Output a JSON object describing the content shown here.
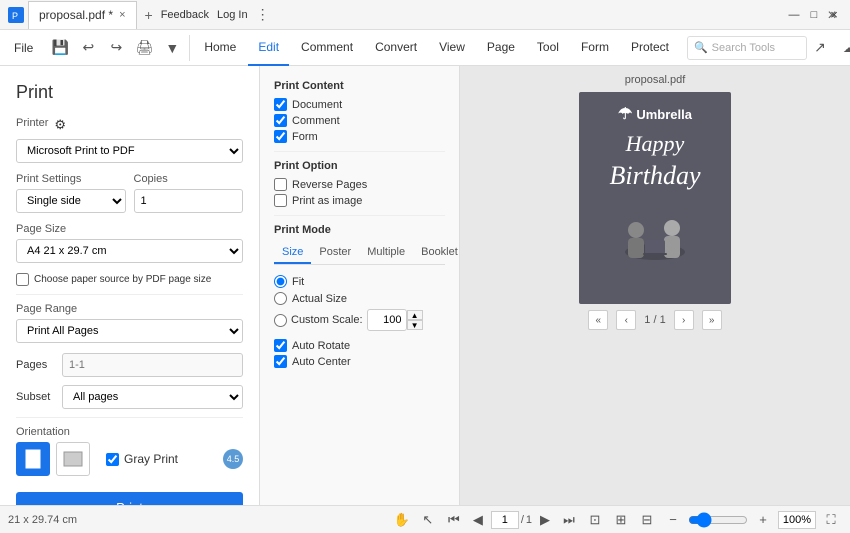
{
  "app": {
    "tab_title": "proposal.pdf *",
    "tab_close": "×",
    "tab_add": "+",
    "feedback": "Feedback",
    "login": "Log In"
  },
  "menubar": {
    "file": "File",
    "nav_items": [
      "Home",
      "Edit",
      "Comment",
      "Convert",
      "View",
      "Page",
      "Tool",
      "Form",
      "Protect"
    ],
    "active_nav": "Edit",
    "search_placeholder": "Search Tools"
  },
  "print": {
    "title": "Print",
    "printer_label": "Printer",
    "printer_value": "Microsoft Print to PDF",
    "settings_label": "Print Settings",
    "settings_value": "Single side",
    "copies_label": "Copies",
    "copies_value": "1",
    "page_size_label": "Page Size",
    "page_size_value": "A4 21 x 29.7 cm",
    "choose_paper": "Choose paper source by PDF page size",
    "page_range_label": "Page Range",
    "page_range_value": "Print All Pages",
    "pages_label": "Pages",
    "pages_placeholder": "1-1",
    "subset_label": "Subset",
    "subset_value": "All pages",
    "orientation_label": "Orientation",
    "gray_print": "Gray Print",
    "print_btn": "Print"
  },
  "print_content": {
    "title": "Print Content",
    "document": "Document",
    "comment": "Comment",
    "form": "Form"
  },
  "print_option": {
    "title": "Print Option",
    "reverse_pages": "Reverse Pages",
    "print_as_image": "Print as image"
  },
  "print_mode": {
    "title": "Print Mode",
    "tabs": [
      "Size",
      "Poster",
      "Multiple",
      "Booklet"
    ],
    "active_tab": "Size",
    "fit": "Fit",
    "actual_size": "Actual Size",
    "custom_scale": "Custom Scale:",
    "scale_value": "100",
    "auto_rotate": "Auto Rotate",
    "auto_center": "Auto Center"
  },
  "preview": {
    "filename": "proposal.pdf",
    "brand": "Umbrella",
    "happy": "Happy",
    "birthday": "Birthday",
    "page_indicator": "1 / 1"
  },
  "bottom": {
    "page_size": "21 x 29.74 cm",
    "page_nav": "1/1",
    "zoom": "100%"
  },
  "window_controls": {
    "minimize": "—",
    "maximize": "□",
    "close": "×"
  }
}
